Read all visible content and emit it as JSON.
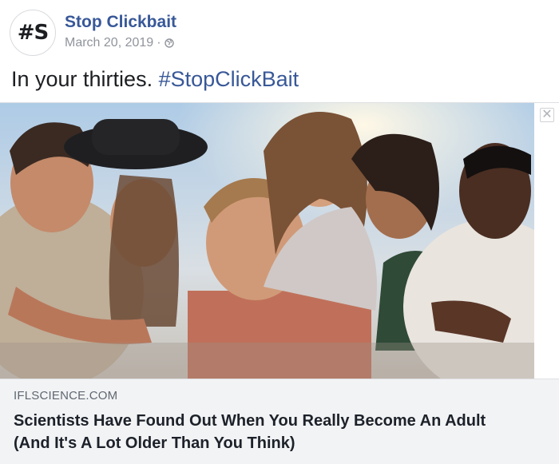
{
  "page": {
    "avatar_text": "#S",
    "name": "Stop Clickbait",
    "date": "March 20, 2019",
    "separator": "·",
    "privacy_icon": "globe-icon"
  },
  "post": {
    "caption_text": "In your thirties.",
    "caption_hashtag": "#StopClickBait"
  },
  "link_preview": {
    "image_icon": "group-photo",
    "close_icon": "close-icon",
    "close_glyph": "✕",
    "domain": "IFLSCIENCE.COM",
    "headline_line1": "Scientists Have Found Out When You Really Become An Adult",
    "headline_line2": "(And It's A Lot Older Than You Think)"
  },
  "colors": {
    "link_blue": "#385898",
    "meta_gray": "#90949c",
    "card_bg": "#f2f3f5"
  }
}
